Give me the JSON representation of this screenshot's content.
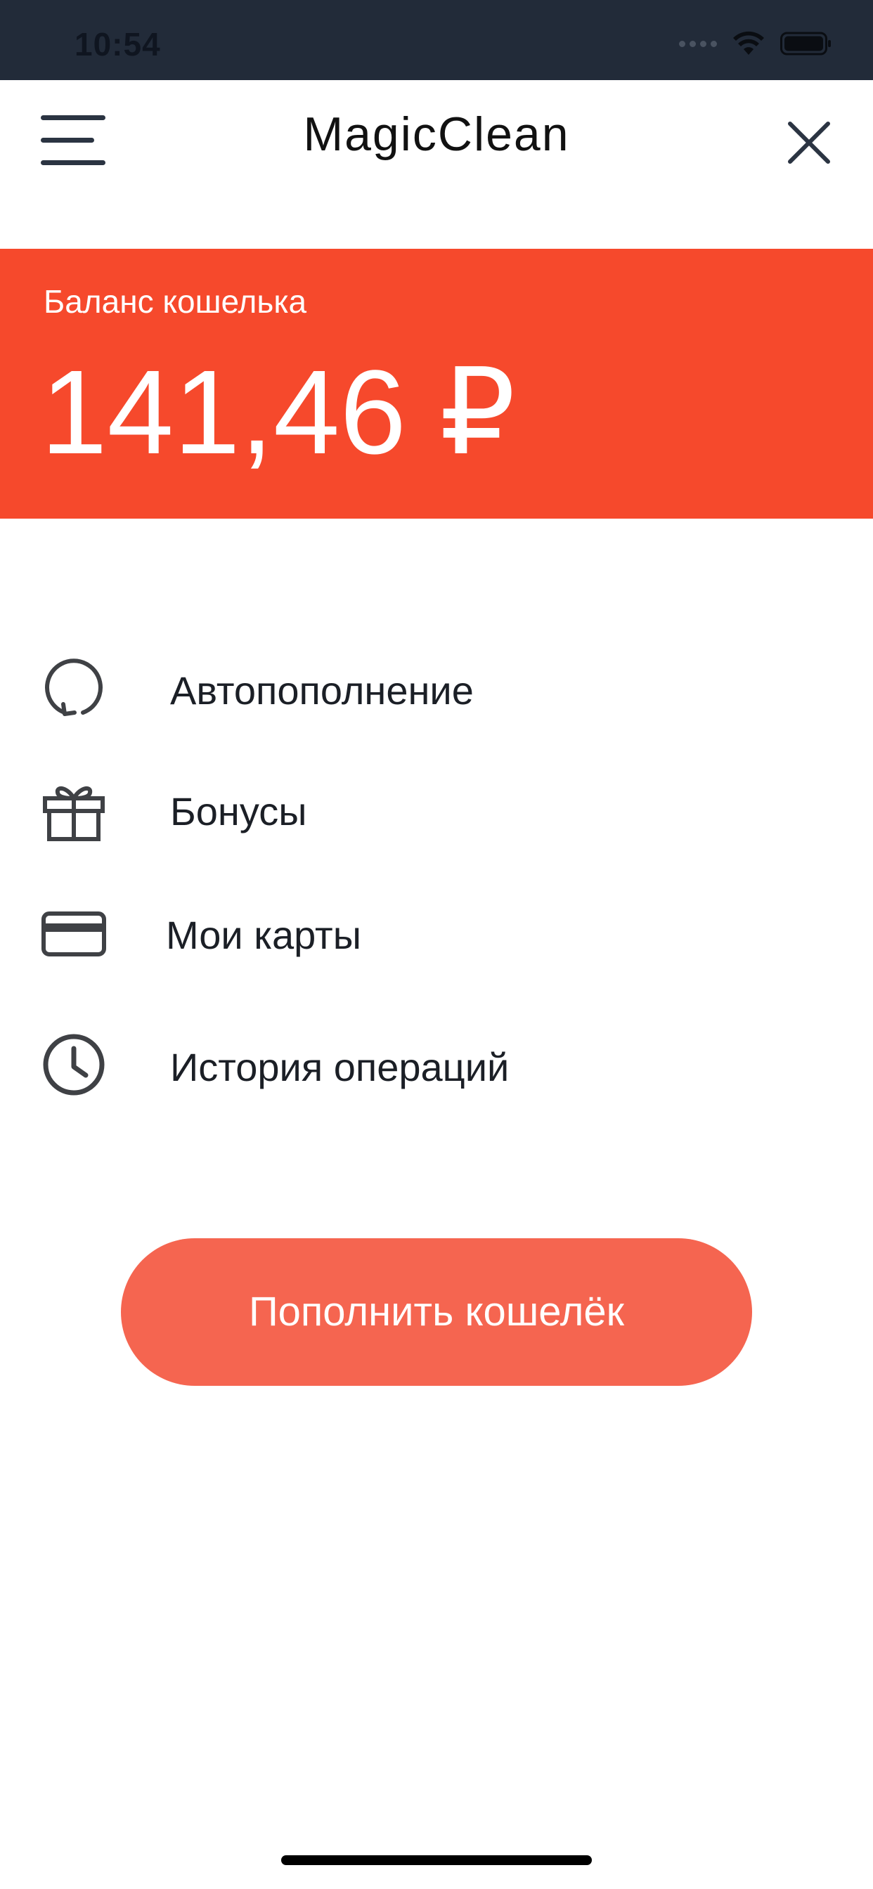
{
  "status_bar": {
    "time": "10:54"
  },
  "header": {
    "logo_text": "MagicClean"
  },
  "balance": {
    "label": "Баланс кошелька",
    "amount": "141,46 ₽"
  },
  "menu": {
    "items": [
      {
        "label": "Автопополнение",
        "icon": "refresh-icon"
      },
      {
        "label": "Бонусы",
        "icon": "gift-icon"
      },
      {
        "label": "Мои карты",
        "icon": "credit-card-icon"
      },
      {
        "label": "История операций",
        "icon": "clock-icon"
      }
    ]
  },
  "cta": {
    "label": "Пополнить кошелёк"
  },
  "colors": {
    "status_bar_bg": "#222b39",
    "accent": "#f6492c",
    "button": "#f56550",
    "icon": "#3f4145"
  }
}
